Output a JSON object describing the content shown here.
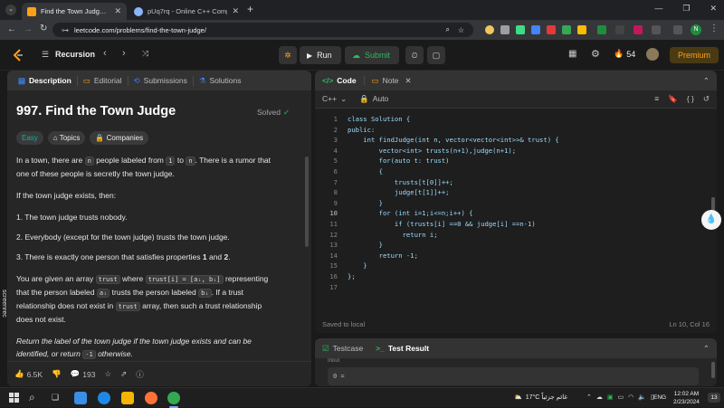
{
  "browser": {
    "tabs": [
      {
        "title": "Find the Town Judge - LeetCode",
        "active": true
      },
      {
        "title": "pUq7rq - Online C++ Compiler",
        "active": false
      }
    ],
    "new_tab": "+",
    "url": "leetcode.com/problems/find-the-town-judge/"
  },
  "nav": {
    "problem_list": "Recursion",
    "run": "Run",
    "submit": "Submit",
    "fire_count": "54",
    "premium": "Premium"
  },
  "left": {
    "tabs": [
      "Description",
      "Editorial",
      "Submissions",
      "Solutions"
    ],
    "title": "997. Find the Town Judge",
    "status": "Solved",
    "badges": {
      "difficulty": "Easy",
      "topics": "Topics",
      "companies": "Companies"
    },
    "p1_a": "In a town, there are",
    "p1_n": "n",
    "p1_b": "people labeled from",
    "p1_1": "1",
    "p1_to": "to",
    "p1_n2": "n",
    "p1_c": ". There is a rumor that",
    "p1_d": "one of these people is secretly the town judge.",
    "p2": "If the town judge exists, then:",
    "li1": "1. The town judge trusts nobody.",
    "li2": "2. Everybody (except for the town judge) trusts the town judge.",
    "li3_a": "3. There is exactly one person that satisfies properties",
    "li3_b": "1",
    "li3_c": "and",
    "li3_d": "2",
    "li3_e": ".",
    "p3_a": "You are given an array",
    "p3_trust": "trust",
    "p3_b": "where",
    "p3_expr": "trust[i] = [aᵢ, bᵢ]",
    "p3_c": "representing",
    "p3_d": "that the person labeled",
    "p3_ai": "aᵢ",
    "p3_e": "trusts the person labeled",
    "p3_bi": "bᵢ",
    "p3_f": ". If a trust",
    "p3_g": "relationship does not exist in",
    "p3_trust2": "trust",
    "p3_h": "array, then such a trust relationship",
    "p3_i": "does not exist.",
    "p4_a": "Return the label of the town judge if the town judge exists and can be",
    "p4_b": "identified, or return",
    "p4_c": "-1",
    "p4_d": "otherwise.",
    "likes": "6.5K",
    "comments": "193"
  },
  "editor": {
    "tabs": [
      "Code",
      "Note"
    ],
    "language": "C++",
    "mode": "Auto",
    "lines": [
      "class Solution {",
      "public:",
      "    int findJudge(int n, vector<vector<int>>& trust) {",
      "        vector<int> trusts(n+1),judge(n+1);",
      "        for(auto t: trust)",
      "        {",
      "            trusts[t[0]]++;",
      "            judge[t[1]]++;",
      "        }",
      "        for (int i=1;i<=n;i++) {",
      "            if (trusts[i] ==0 && judge[i] ==n-1)",
      "              return i;",
      "        }",
      "        return -1;",
      "    }",
      "};",
      ""
    ],
    "saved": "Saved to local",
    "cursor": "Ln 10, Col 16"
  },
  "bottom": {
    "tabs": [
      "Testcase",
      "Test Result"
    ],
    "input_label": "Input",
    "input_value": "0 ="
  },
  "taskbar": {
    "weather": "17°C غائم جزئياً",
    "lang": "ENG",
    "time": "12:02 AM",
    "date": "2/23/2024",
    "notif": "13"
  },
  "watermark": "screenrec"
}
